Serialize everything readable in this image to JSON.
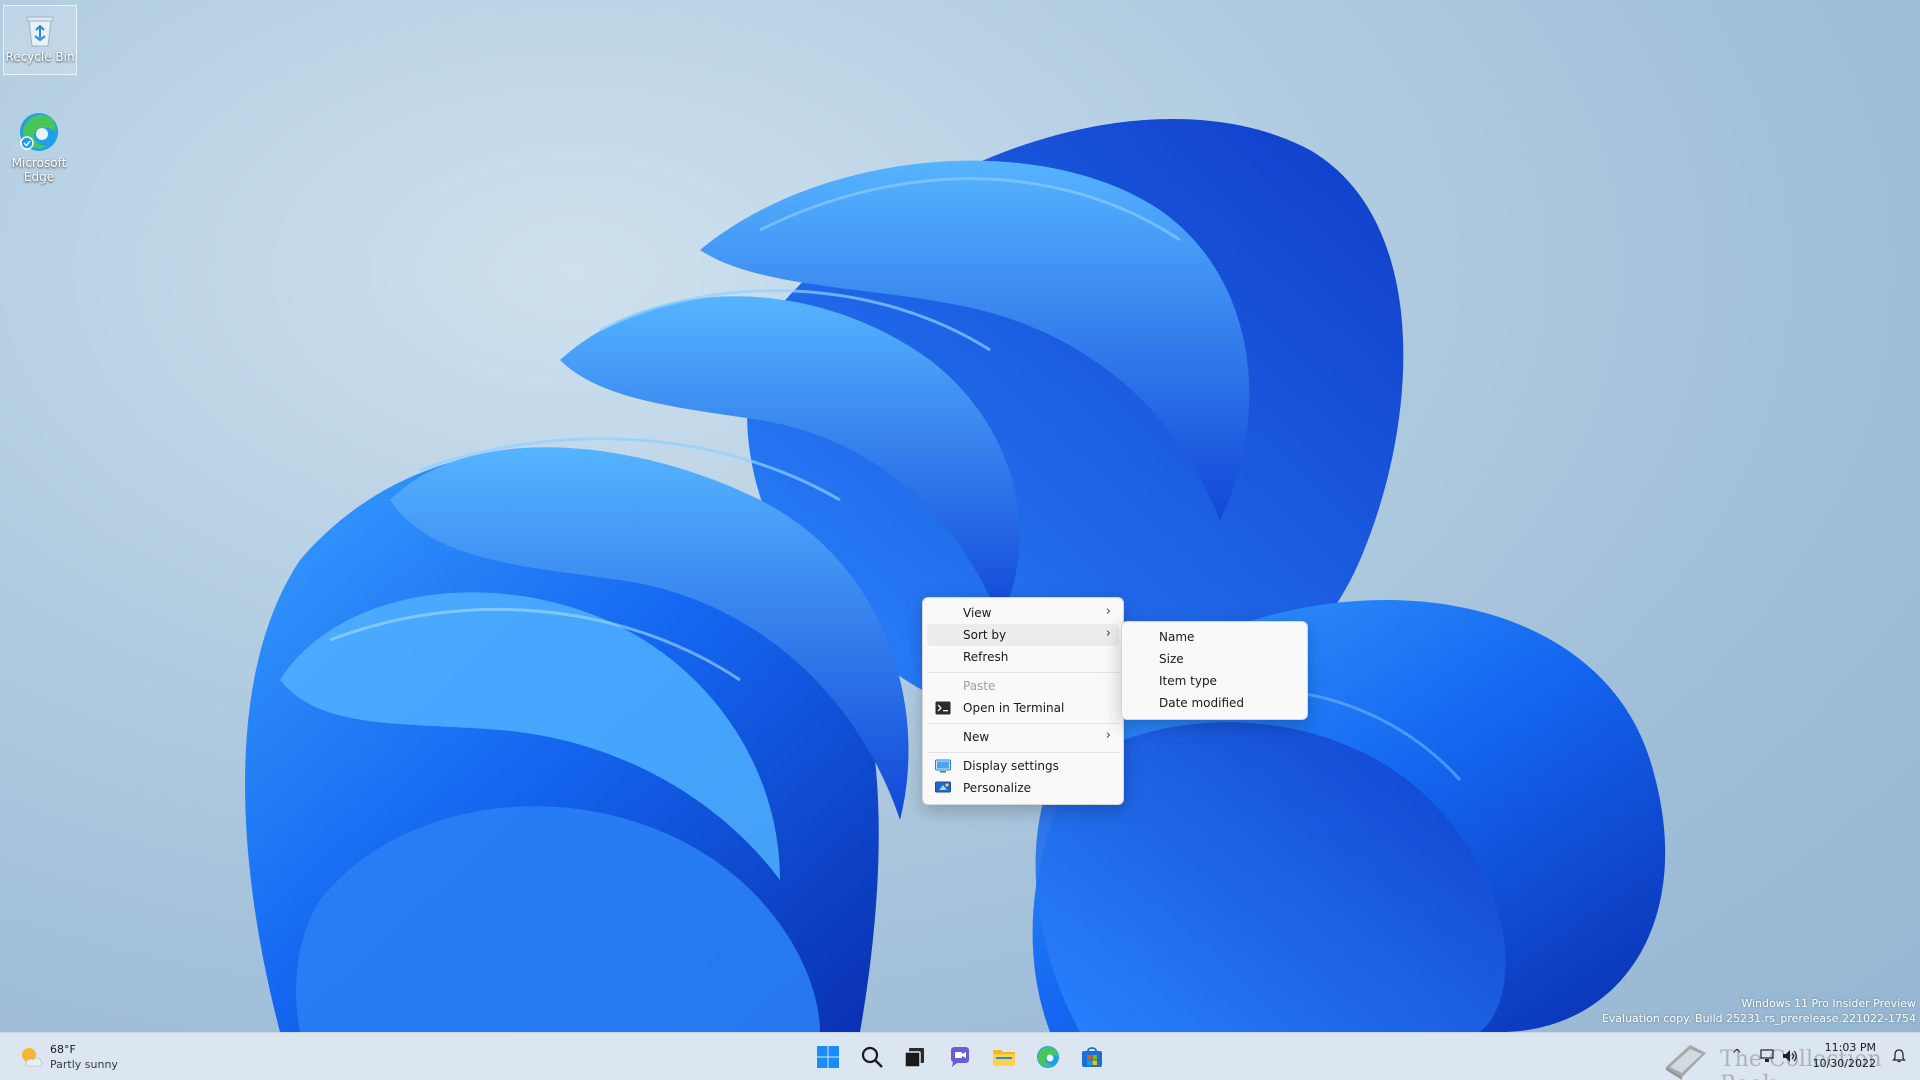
{
  "desktop": {
    "icons": [
      {
        "label": "Recycle Bin"
      },
      {
        "label": "Microsoft Edge"
      }
    ]
  },
  "context_menu": {
    "items": [
      {
        "label": "View",
        "submenu": true
      },
      {
        "label": "Sort by",
        "submenu": true,
        "highlighted": true
      },
      {
        "label": "Refresh"
      },
      {
        "label": "Paste",
        "disabled": true
      },
      {
        "label": "Open in Terminal",
        "icon": "terminal-icon"
      },
      {
        "label": "New",
        "submenu": true
      },
      {
        "label": "Display settings",
        "icon": "display-settings-icon"
      },
      {
        "label": "Personalize",
        "icon": "personalize-icon"
      }
    ],
    "chevron": "›"
  },
  "sort_submenu": {
    "items": [
      {
        "label": "Name"
      },
      {
        "label": "Size"
      },
      {
        "label": "Item type"
      },
      {
        "label": "Date modified"
      }
    ]
  },
  "watermark": {
    "line1": "Windows 11 Pro Insider Preview",
    "line2": "Evaluation copy. Build 25231.rs_prerelease.221022-1754"
  },
  "taskbar": {
    "weather": {
      "temp": "68°F",
      "condition": "Partly sunny",
      "icon": "partly-sunny-icon"
    },
    "apps": [
      {
        "name": "start-button",
        "icon": "windows-logo-icon"
      },
      {
        "name": "search-button",
        "icon": "search-icon"
      },
      {
        "name": "task-view-button",
        "icon": "task-view-icon"
      },
      {
        "name": "chat-button",
        "icon": "chat-icon"
      },
      {
        "name": "file-explorer-button",
        "icon": "folder-icon"
      },
      {
        "name": "edge-button",
        "icon": "edge-icon"
      },
      {
        "name": "store-button",
        "icon": "store-icon"
      }
    ],
    "tray": {
      "chevron": "^",
      "time": "11:03 PM",
      "date": "10/30/2022",
      "logo_text": "The Collection Book"
    }
  },
  "colors": {
    "accent": "#0067c0",
    "menu_bg": "#f9f9f9",
    "taskbar_bg": "#dbe6f0"
  }
}
